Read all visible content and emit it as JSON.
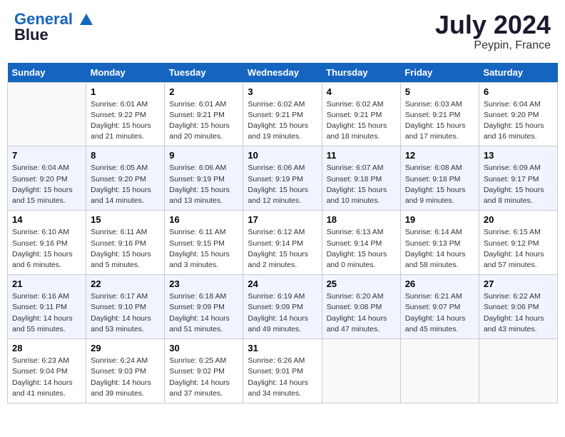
{
  "header": {
    "logo_line1": "General",
    "logo_line2": "Blue",
    "month_year": "July 2024",
    "location": "Peypin, France"
  },
  "days_of_week": [
    "Sunday",
    "Monday",
    "Tuesday",
    "Wednesday",
    "Thursday",
    "Friday",
    "Saturday"
  ],
  "weeks": [
    [
      {
        "day": "",
        "empty": true
      },
      {
        "day": "1",
        "sunrise": "6:01 AM",
        "sunset": "9:22 PM",
        "daylight": "15 hours and 21 minutes."
      },
      {
        "day": "2",
        "sunrise": "6:01 AM",
        "sunset": "9:21 PM",
        "daylight": "15 hours and 20 minutes."
      },
      {
        "day": "3",
        "sunrise": "6:02 AM",
        "sunset": "9:21 PM",
        "daylight": "15 hours and 19 minutes."
      },
      {
        "day": "4",
        "sunrise": "6:02 AM",
        "sunset": "9:21 PM",
        "daylight": "15 hours and 18 minutes."
      },
      {
        "day": "5",
        "sunrise": "6:03 AM",
        "sunset": "9:21 PM",
        "daylight": "15 hours and 17 minutes."
      },
      {
        "day": "6",
        "sunrise": "6:04 AM",
        "sunset": "9:20 PM",
        "daylight": "15 hours and 16 minutes."
      }
    ],
    [
      {
        "day": "7",
        "sunrise": "6:04 AM",
        "sunset": "9:20 PM",
        "daylight": "15 hours and 15 minutes."
      },
      {
        "day": "8",
        "sunrise": "6:05 AM",
        "sunset": "9:20 PM",
        "daylight": "15 hours and 14 minutes."
      },
      {
        "day": "9",
        "sunrise": "6:06 AM",
        "sunset": "9:19 PM",
        "daylight": "15 hours and 13 minutes."
      },
      {
        "day": "10",
        "sunrise": "6:06 AM",
        "sunset": "9:19 PM",
        "daylight": "15 hours and 12 minutes."
      },
      {
        "day": "11",
        "sunrise": "6:07 AM",
        "sunset": "9:18 PM",
        "daylight": "15 hours and 10 minutes."
      },
      {
        "day": "12",
        "sunrise": "6:08 AM",
        "sunset": "9:18 PM",
        "daylight": "15 hours and 9 minutes."
      },
      {
        "day": "13",
        "sunrise": "6:09 AM",
        "sunset": "9:17 PM",
        "daylight": "15 hours and 8 minutes."
      }
    ],
    [
      {
        "day": "14",
        "sunrise": "6:10 AM",
        "sunset": "9:16 PM",
        "daylight": "15 hours and 6 minutes."
      },
      {
        "day": "15",
        "sunrise": "6:11 AM",
        "sunset": "9:16 PM",
        "daylight": "15 hours and 5 minutes."
      },
      {
        "day": "16",
        "sunrise": "6:11 AM",
        "sunset": "9:15 PM",
        "daylight": "15 hours and 3 minutes."
      },
      {
        "day": "17",
        "sunrise": "6:12 AM",
        "sunset": "9:14 PM",
        "daylight": "15 hours and 2 minutes."
      },
      {
        "day": "18",
        "sunrise": "6:13 AM",
        "sunset": "9:14 PM",
        "daylight": "15 hours and 0 minutes."
      },
      {
        "day": "19",
        "sunrise": "6:14 AM",
        "sunset": "9:13 PM",
        "daylight": "14 hours and 58 minutes."
      },
      {
        "day": "20",
        "sunrise": "6:15 AM",
        "sunset": "9:12 PM",
        "daylight": "14 hours and 57 minutes."
      }
    ],
    [
      {
        "day": "21",
        "sunrise": "6:16 AM",
        "sunset": "9:11 PM",
        "daylight": "14 hours and 55 minutes."
      },
      {
        "day": "22",
        "sunrise": "6:17 AM",
        "sunset": "9:10 PM",
        "daylight": "14 hours and 53 minutes."
      },
      {
        "day": "23",
        "sunrise": "6:18 AM",
        "sunset": "9:09 PM",
        "daylight": "14 hours and 51 minutes."
      },
      {
        "day": "24",
        "sunrise": "6:19 AM",
        "sunset": "9:09 PM",
        "daylight": "14 hours and 49 minutes."
      },
      {
        "day": "25",
        "sunrise": "6:20 AM",
        "sunset": "9:08 PM",
        "daylight": "14 hours and 47 minutes."
      },
      {
        "day": "26",
        "sunrise": "6:21 AM",
        "sunset": "9:07 PM",
        "daylight": "14 hours and 45 minutes."
      },
      {
        "day": "27",
        "sunrise": "6:22 AM",
        "sunset": "9:06 PM",
        "daylight": "14 hours and 43 minutes."
      }
    ],
    [
      {
        "day": "28",
        "sunrise": "6:23 AM",
        "sunset": "9:04 PM",
        "daylight": "14 hours and 41 minutes."
      },
      {
        "day": "29",
        "sunrise": "6:24 AM",
        "sunset": "9:03 PM",
        "daylight": "14 hours and 39 minutes."
      },
      {
        "day": "30",
        "sunrise": "6:25 AM",
        "sunset": "9:02 PM",
        "daylight": "14 hours and 37 minutes."
      },
      {
        "day": "31",
        "sunrise": "6:26 AM",
        "sunset": "9:01 PM",
        "daylight": "14 hours and 34 minutes."
      },
      {
        "day": "",
        "empty": true
      },
      {
        "day": "",
        "empty": true
      },
      {
        "day": "",
        "empty": true
      }
    ]
  ],
  "labels": {
    "sunrise_prefix": "Sunrise: ",
    "sunset_prefix": "Sunset: ",
    "daylight_prefix": "Daylight: "
  }
}
